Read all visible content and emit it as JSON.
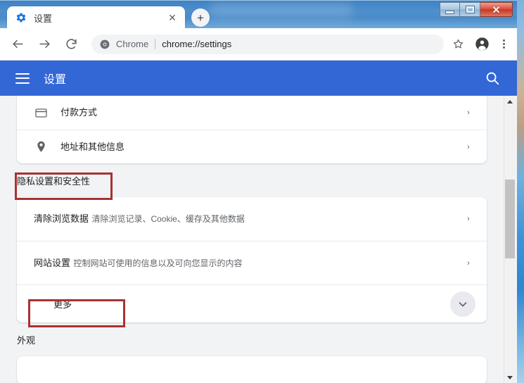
{
  "window": {
    "controls": {
      "minimize_label": "–",
      "maximize_label": "□",
      "close_label": "✕"
    }
  },
  "tab_strip": {
    "active_tab": {
      "title": "设置",
      "favicon": "settings-gear-icon",
      "close_label": "✕"
    },
    "new_tab_label": "+"
  },
  "toolbar": {
    "back_icon": "arrow-back-icon",
    "forward_icon": "arrow-forward-icon",
    "reload_icon": "reload-icon",
    "omnibox": {
      "site_icon": "chrome-logo-icon",
      "scheme_label": "Chrome",
      "url": "chrome://settings"
    },
    "bookmark_icon": "star-outline-icon",
    "profile_icon": "account-circle-icon",
    "menu_icon": "three-dot-menu-icon"
  },
  "settings_header": {
    "menu_icon": "hamburger-menu-icon",
    "title": "设置",
    "search_icon": "search-icon"
  },
  "settings_content": {
    "autofill_rows": [
      {
        "icon": "credit-card-icon",
        "title": "付款方式",
        "arrow": "›"
      },
      {
        "icon": "location-pin-icon",
        "title": "地址和其他信息",
        "arrow": "›"
      }
    ],
    "privacy_section_title": "隐私设置和安全性",
    "privacy_rows": [
      {
        "title": "清除浏览数据",
        "subtitle": "清除浏览记录、Cookie、缓存及其他数据",
        "arrow": "›"
      },
      {
        "title": "网站设置",
        "subtitle": "控制网站可使用的信息以及可向您显示的内容",
        "arrow": "›"
      }
    ],
    "more_row": {
      "label": "更多",
      "expand_icon": "chevron-down-icon"
    },
    "appearance_section_title": "外观"
  },
  "annotations": [
    {
      "name": "privacy-and-security-highlight",
      "color": "#a83232"
    },
    {
      "name": "more-row-highlight",
      "color": "#a83232"
    }
  ],
  "scrollbar": {
    "up_arrow_icon": "triangle-up-icon",
    "down_arrow_icon": "triangle-down-icon"
  }
}
